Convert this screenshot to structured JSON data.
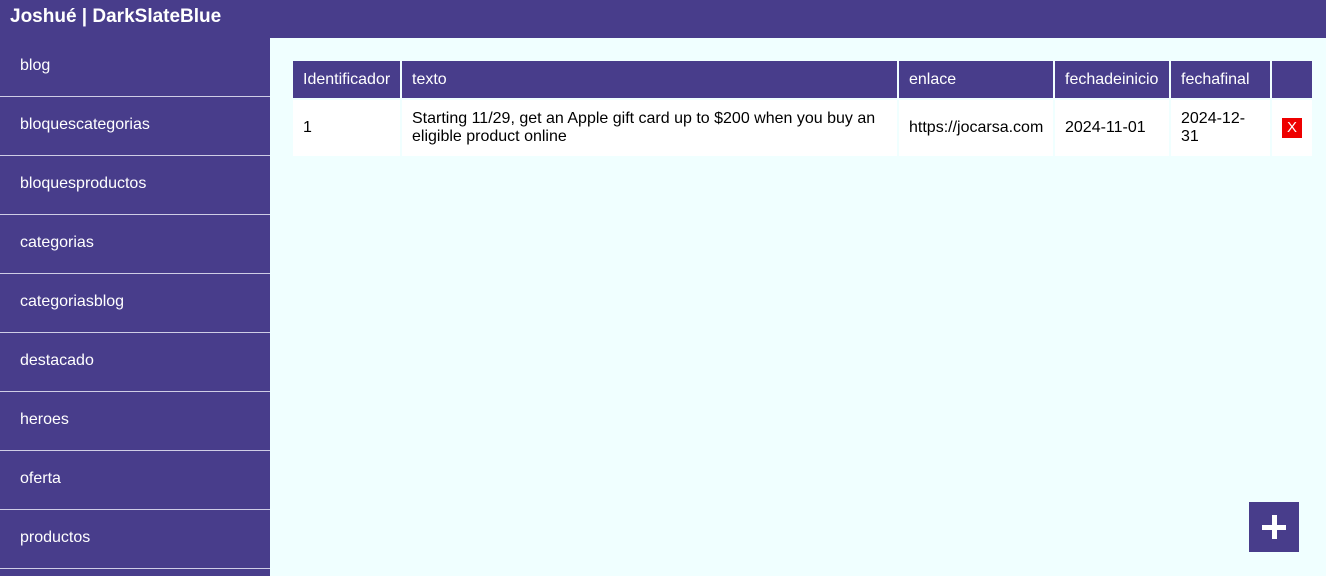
{
  "header": {
    "title": "Joshué | DarkSlateBlue"
  },
  "sidebar": {
    "items": [
      {
        "label": "blog"
      },
      {
        "label": "bloquescategorias"
      },
      {
        "label": "bloquesproductos"
      },
      {
        "label": "categorias"
      },
      {
        "label": "categoriasblog"
      },
      {
        "label": "destacado"
      },
      {
        "label": "heroes"
      },
      {
        "label": "oferta"
      },
      {
        "label": "productos"
      }
    ]
  },
  "table": {
    "columns": [
      "Identificador",
      "texto",
      "enlace",
      "fechadeinicio",
      "fechafinal",
      ""
    ],
    "rows": [
      {
        "id": "1",
        "texto": "Starting 11/29, get an Apple gift card up to $200 when you buy an eligible product online",
        "enlace": "https://jocarsa.com",
        "fechadeinicio": "2024-11-01",
        "fechafinal": "2024-12-31",
        "delete_label": "X"
      }
    ]
  },
  "actions": {
    "add_icon": "plus-icon"
  },
  "colors": {
    "accent": "#483d8b",
    "background": "#f0ffff",
    "delete": "#ee0000"
  }
}
